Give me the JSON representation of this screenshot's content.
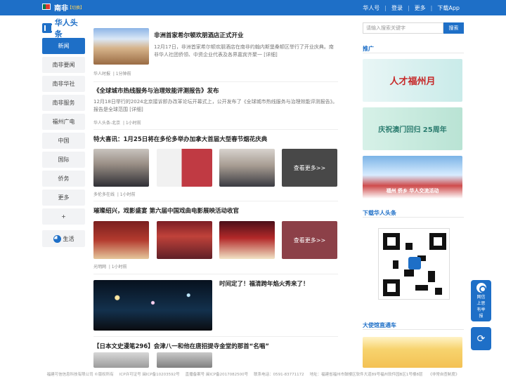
{
  "topbar": {
    "site_name": "南非",
    "switch_label": "【切换】",
    "links": [
      "华人号",
      "登录",
      "更多",
      "下载App"
    ]
  },
  "left_nav": {
    "logo_text": "华人头条",
    "items": [
      "新闻",
      "南非要闻",
      "南非华社",
      "南非服务",
      "福州广电",
      "中国",
      "国际",
      "侨务",
      "更多",
      "+"
    ],
    "life_label": "生活"
  },
  "articles": [
    {
      "title": "非洲首家希尔顿欢朋酒店正式开业",
      "desc": "12月17日，非洲首家希尔顿欢朋酒店在南非约翰内斯堡桑顿区举行了开业庆典。南非华人社团侨领、中资企业代表及各界嘉宾齐聚一 [详细]",
      "meta_source": "华人时报",
      "meta_time": "1分钟前"
    },
    {
      "title": "《全球城市热线服务与治理效能评测报告》发布",
      "desc": "12月18日举行的2024北京接诉即办改革论坛开幕式上，公开发布了《全球城市热线服务与治理效能评测报告》。报告是全球范围 [详细]",
      "meta_source": "华人头条-北京",
      "meta_time": "1小时前"
    },
    {
      "title": "特大喜讯：1月25日将在多伦多举办加拿大首届大型春节烟花庆典",
      "more": "查看更多>>",
      "meta_source": "多伦多在线",
      "meta_time": "1小时前"
    },
    {
      "title": "璀璨绍兴，戏影盛宴 第六届中国戏曲电影展映活动收官",
      "more": "查看更多>>",
      "meta_source": "光明网",
      "meta_time": "1小时前"
    },
    {
      "title": "时间定了！福清跨年焰火秀来了！"
    },
    {
      "title": "【日本文史漫笔296】会津八一和他在唐招提寺金堂的那首“名唱”"
    }
  ],
  "right": {
    "search_placeholder": "请输入搜索关键字",
    "search_button": "搜索",
    "section_promo": "推广",
    "section_download": "下载华人头条",
    "section_embassy": "大使馆直通车",
    "ad1_text": "人才福州月",
    "ad2_text": "庆祝澳门回归 25周年",
    "ad3_text": "福州 侨乡  华人交流活动"
  },
  "floating": {
    "report_label": "网信上思有举报"
  },
  "footer": {
    "items": [
      "福建可信信息科技有限公司 ©版权所有",
      "ICP许可证号 闽ICP备10203592号",
      "直播备案号 闽ICP备2017082500号",
      "联系电话：0591-83771172",
      "地址：福建省福州市鼓楼区软件大道89号福州软件园B区1号楼8层",
      "《非常自查制度》"
    ]
  },
  "colors": {
    "brand": "#1e6fc7"
  }
}
